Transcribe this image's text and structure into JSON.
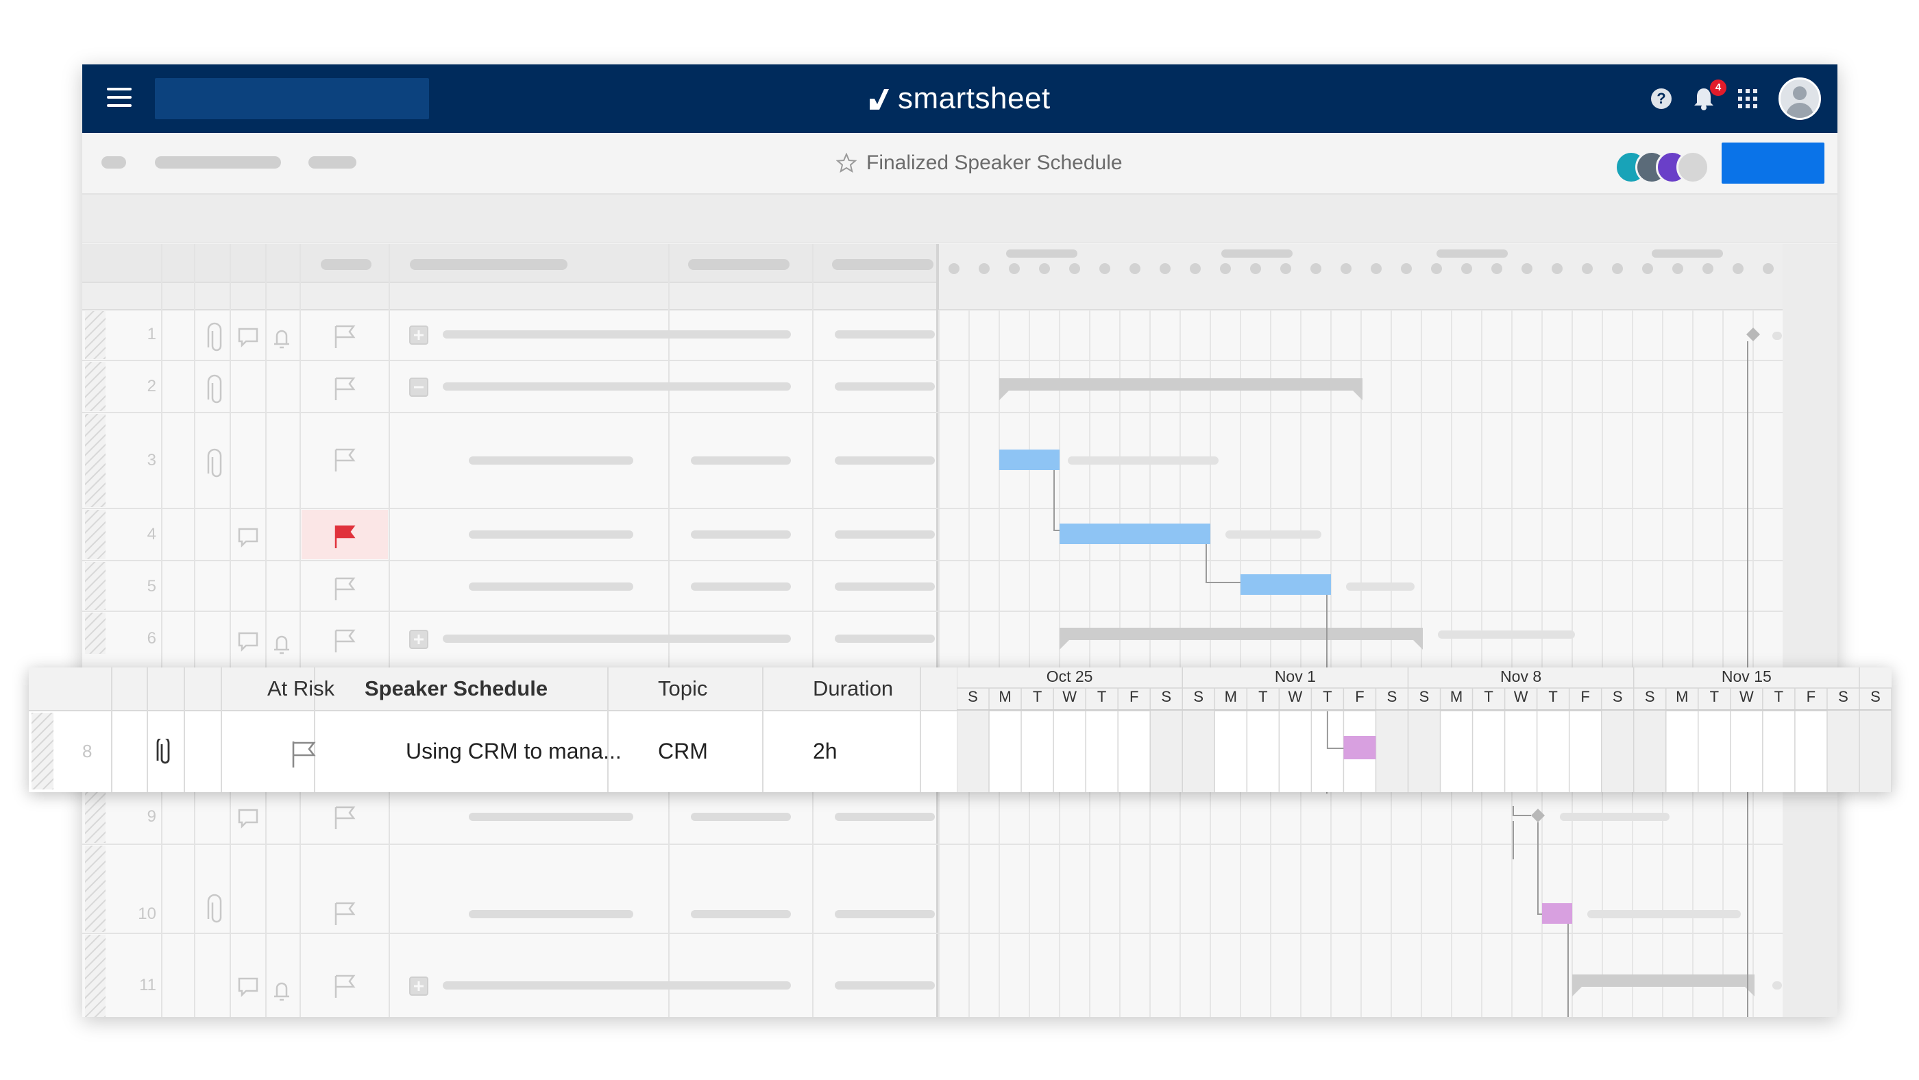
{
  "app": {
    "brand": "smartsheet",
    "notification_count": "4",
    "sheet_title": "Finalized Speaker Schedule"
  },
  "grid": {
    "row_numbers": [
      "1",
      "2",
      "3",
      "4",
      "5",
      "6",
      "9",
      "10",
      "11"
    ]
  },
  "overlay": {
    "columns": {
      "at_risk": "At Risk",
      "primary": "Speaker Schedule",
      "topic": "Topic",
      "duration": "Duration"
    },
    "row": {
      "number": "8",
      "primary": "Using CRM to mana...",
      "topic": "CRM",
      "duration": "2h"
    },
    "gantt_weeks": [
      "Oct 25",
      "Nov 1",
      "Nov 8",
      "Nov 15"
    ],
    "gantt_days": [
      "S",
      "M",
      "T",
      "W",
      "T",
      "F",
      "S",
      "S",
      "M",
      "T",
      "W",
      "T",
      "F",
      "S",
      "S",
      "M",
      "T",
      "W",
      "T",
      "F",
      "S",
      "S",
      "M",
      "T",
      "W",
      "T",
      "F",
      "S",
      "S"
    ]
  },
  "colors": {
    "topbar": "#002b5c",
    "accent": "#0a73e8",
    "task_bar": "#8ec4f4",
    "milestone_bar": "#d8a0e0",
    "flag_at_risk": "#e0323c"
  }
}
